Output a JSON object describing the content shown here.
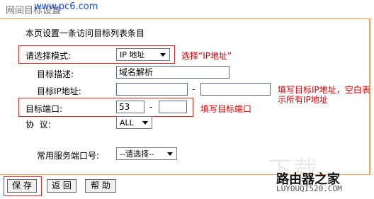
{
  "header": {
    "title": "网间目标设置",
    "watermark": "www.pc6.com"
  },
  "intro": "本页设置一条访问目标列表条目",
  "form": {
    "mode": {
      "label": "请选择模式:",
      "value": "IP 地址",
      "annotation": "选择“IP地址”"
    },
    "description": {
      "label": "目标描述:",
      "value": "域名解析"
    },
    "ip": {
      "label": "目标IP地址:",
      "start": "",
      "end": "",
      "separator": "-",
      "annotation_line1": "填写目标IP地址，空白表",
      "annotation_line2": "示所有IP地址"
    },
    "port": {
      "label": "目标端口:",
      "start": "53",
      "end": "",
      "separator": "-",
      "annotation": "填写目标端口"
    },
    "protocol": {
      "label": "协  议:",
      "value": "ALL"
    },
    "common_port": {
      "label": "常用服务端口号:",
      "value": "--请选择--"
    }
  },
  "buttons": {
    "save": "保 存",
    "back": "返 回",
    "help": "帮 助"
  },
  "brand": {
    "ghost": "下载",
    "name": "路由器之家",
    "url": "LUYOUQI520.COM"
  }
}
